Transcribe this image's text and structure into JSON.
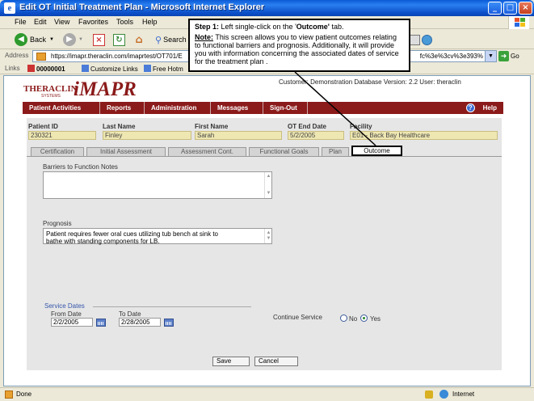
{
  "window": {
    "title": "Edit OT Initial Treatment Plan - Microsoft Internet Explorer"
  },
  "menu": [
    "File",
    "Edit",
    "View",
    "Favorites",
    "Tools",
    "Help"
  ],
  "toolbar": {
    "back_label": "Back",
    "search_label": "Search"
  },
  "address": {
    "label": "Address",
    "url": "https://imapr.theraclin.com/imaprtest/OT701/E",
    "url_tail": "fc%3e%3cv%3e393%",
    "go_label": "Go"
  },
  "links": {
    "label": "Links",
    "items": [
      "00000001",
      "Customize Links",
      "Free Hotm"
    ]
  },
  "app": {
    "brand_theraclin": "THERACLIN",
    "brand_systems": "SYSTEMS",
    "brand_imapr": "iMAPR",
    "customer_line": "Customer: Demonstration Database Version: 2.2 User: theraclin",
    "nav": [
      "Patient Activities",
      "Reports",
      "Administration",
      "Messages",
      "Sign-Out"
    ],
    "help_label": "Help"
  },
  "patient": {
    "id_label": "Patient ID",
    "id": "230321",
    "last_label": "Last Name",
    "last": "Finley",
    "first_label": "First Name",
    "first": "Sarah",
    "end_label": "OT End Date",
    "end": "5/2/2005",
    "facility_label": "Facility",
    "facility": "E01 - Back Bay Healthcare"
  },
  "tabs": [
    "Certification",
    "Initial Assessment",
    "Assessment Cont.",
    "Functional Goals",
    "Plan",
    "Outcome"
  ],
  "outcome": {
    "barriers_label": "Barriers to Function Notes",
    "barriers_value": "",
    "prognosis_label": "Prognosis",
    "prognosis_line1": "Patient requires fewer oral cues utilizing tub bench at sink to",
    "prognosis_line2": "bathe with standing components for LB.",
    "service_dates_label": "Service Dates",
    "from_label": "From Date",
    "from_value": "2/2/2005",
    "to_label": "To Date",
    "to_value": "2/28/2005",
    "continue_label": "Continue Service",
    "no_label": "No",
    "yes_label": "Yes",
    "selected": "Yes"
  },
  "buttons": {
    "save": "Save",
    "cancel": "Cancel"
  },
  "status": {
    "left": "Done",
    "zone": "Internet"
  },
  "callout": {
    "step": "Step 1:",
    "instruction_pre": " Left single-click on the '",
    "instruction_tab": "Outcome'",
    "instruction_post": " tab.",
    "note_label": "Note:",
    "note_text": " This screen allows you to view patient outcomes relating to functional barriers and prognosis. Additionally, it will provide you with information concerning the associated dates of service for the treatment plan ."
  }
}
